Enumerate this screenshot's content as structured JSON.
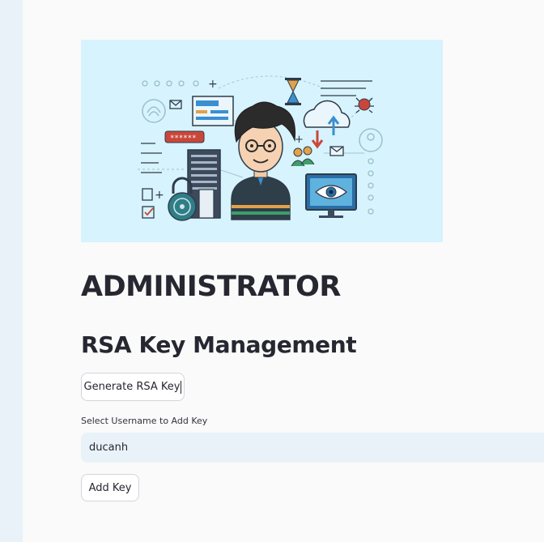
{
  "page": {
    "title": "ADMINISTRATOR",
    "subtitle": "RSA Key Management"
  },
  "actions": {
    "generate_label": "Generate RSA Key",
    "add_label": "Add Key"
  },
  "username_select": {
    "label": "Select Username to Add Key",
    "selected_value": "ducanh"
  },
  "hero_image": {
    "banner_stars": "******"
  },
  "colors": {
    "sidebar_bg": "#e9f2f9",
    "main_bg": "#fafafa",
    "hero_bg": "#d7f3fd",
    "select_bg": "#e9f2f9",
    "text": "#262730"
  }
}
